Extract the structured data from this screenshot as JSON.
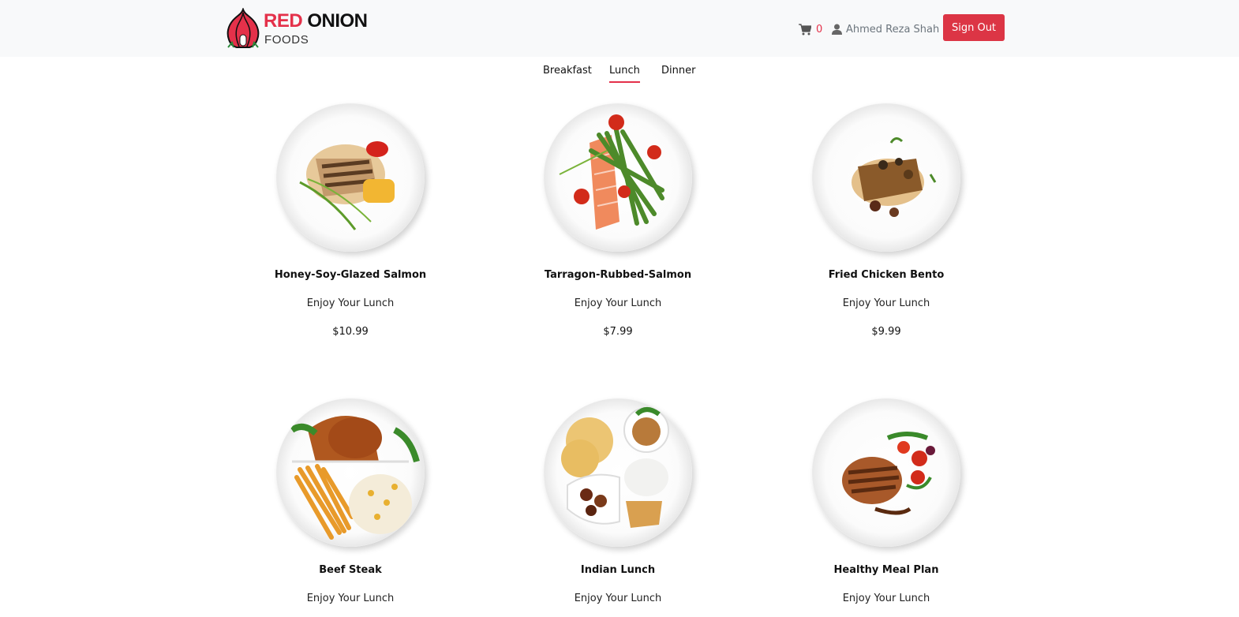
{
  "brand": {
    "name_red": "RED",
    "name_black": "ONION",
    "subtitle": "FOODS",
    "accent": "#e4314a"
  },
  "header": {
    "cart_icon": "cart-icon",
    "cart_count": "0",
    "user_icon": "user-icon",
    "user_name": "Ahmed Reza Shah",
    "signout_label": "Sign Out"
  },
  "tabs": [
    {
      "label": "Breakfast",
      "active": false
    },
    {
      "label": "Lunch",
      "active": true
    },
    {
      "label": "Dinner",
      "active": false
    }
  ],
  "foods": [
    {
      "name": "Honey-Soy-Glazed Salmon",
      "subtitle": "Enjoy Your Lunch",
      "price": "$10.99"
    },
    {
      "name": "Tarragon-Rubbed-Salmon",
      "subtitle": "Enjoy Your Lunch",
      "price": "$7.99"
    },
    {
      "name": "Fried Chicken Bento",
      "subtitle": "Enjoy Your Lunch",
      "price": "$9.99"
    },
    {
      "name": "Beef Steak",
      "subtitle": "Enjoy Your Lunch",
      "price": ""
    },
    {
      "name": "Indian Lunch",
      "subtitle": "Enjoy Your Lunch",
      "price": ""
    },
    {
      "name": "Healthy Meal Plan",
      "subtitle": "Enjoy Your Lunch",
      "price": ""
    }
  ]
}
